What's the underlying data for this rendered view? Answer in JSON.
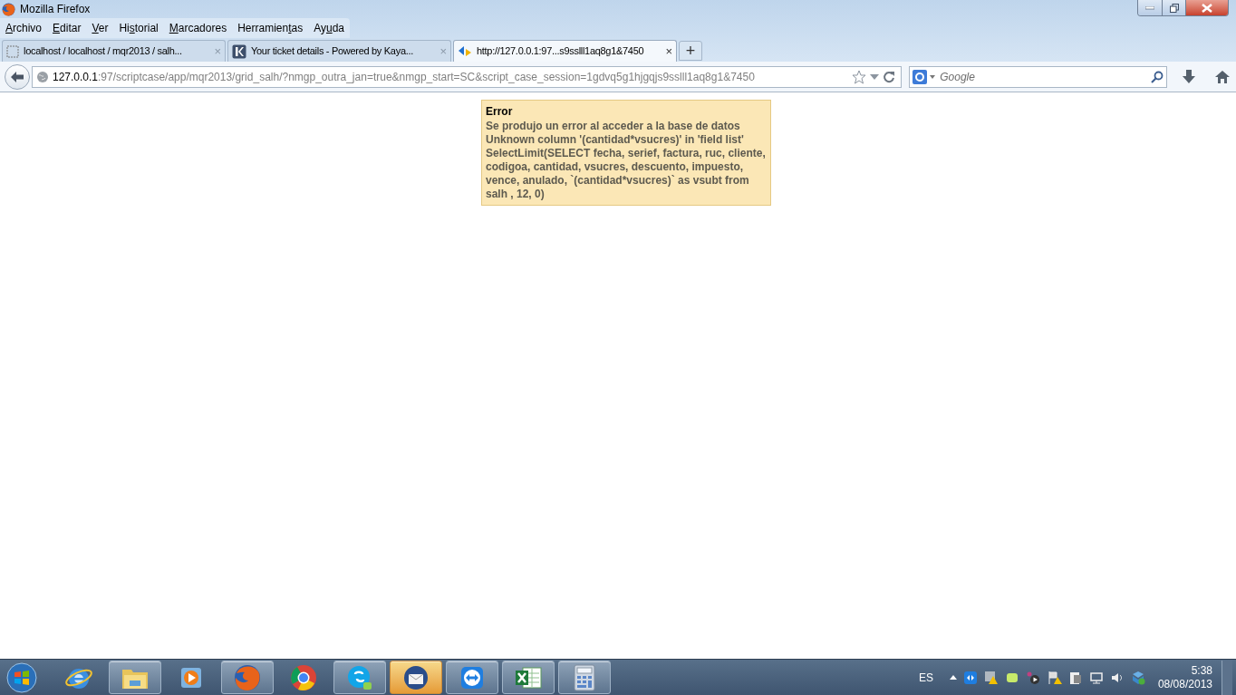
{
  "window": {
    "title": "Mozilla Firefox"
  },
  "menu": [
    {
      "key": "A",
      "after": "rchivo"
    },
    {
      "key": "E",
      "after": "ditar"
    },
    {
      "key": "V",
      "after": "er"
    },
    {
      "before": "Hi",
      "key": "s",
      "after": "torial"
    },
    {
      "key": "M",
      "after": "arcadores"
    },
    {
      "before": "Herramien",
      "key": "t",
      "after": "as"
    },
    {
      "before": "Ay",
      "key": "u",
      "after": "da"
    }
  ],
  "tabs": [
    {
      "title": "localhost / localhost / mqr2013 / salh...",
      "close": "×",
      "selected": false,
      "kind": "blank"
    },
    {
      "title": "Your ticket details - Powered by Kaya...",
      "close": "×",
      "selected": false,
      "kind": "square"
    },
    {
      "title": "http://127.0.0.1:97...s9sslll1aq8g1&7450",
      "close": "×",
      "selected": true,
      "kind": "arrows"
    }
  ],
  "new_tab": "+",
  "address_bar": {
    "host": "127.0.0.1",
    "rest": ":97/scriptcase/app/mqr2013/grid_salh/?nmgp_outra_jan=true&nmgp_start=SC&script_case_session=1gdvq5g1hjgqjs9sslll1aq8g1&7450"
  },
  "search": {
    "placeholder": "Google"
  },
  "error": {
    "title": "Error",
    "lines": [
      "Se produjo un error al acceder a la base de datos",
      "Unknown column '(cantidad*vsucres)' in 'field list'",
      "SelectLimit(SELECT fecha, serief, factura, ruc, cliente, codigoa, cantidad, vsucres, descuento, impuesto, vence, anulado, `(cantidad*vsucres)` as vsubt from salh , 12, 0)"
    ]
  },
  "taskbar": {
    "apps": [
      {
        "kind": "ie",
        "running": false,
        "highlighted": false
      },
      {
        "kind": "explorer",
        "running": true,
        "highlighted": false
      },
      {
        "kind": "media",
        "running": false,
        "highlighted": false
      },
      {
        "kind": "firefox",
        "running": true,
        "highlighted": false
      },
      {
        "kind": "chrome",
        "running": false,
        "highlighted": false
      },
      {
        "kind": "skype",
        "running": true,
        "highlighted": false
      },
      {
        "kind": "thunderbird",
        "running": true,
        "highlighted": true
      },
      {
        "kind": "teamviewer",
        "running": true,
        "highlighted": false
      },
      {
        "kind": "excel",
        "running": true,
        "highlighted": false
      },
      {
        "kind": "calculator",
        "running": true,
        "highlighted": false
      }
    ],
    "language": "ES",
    "time": "5:38",
    "date": "08/08/2013"
  }
}
